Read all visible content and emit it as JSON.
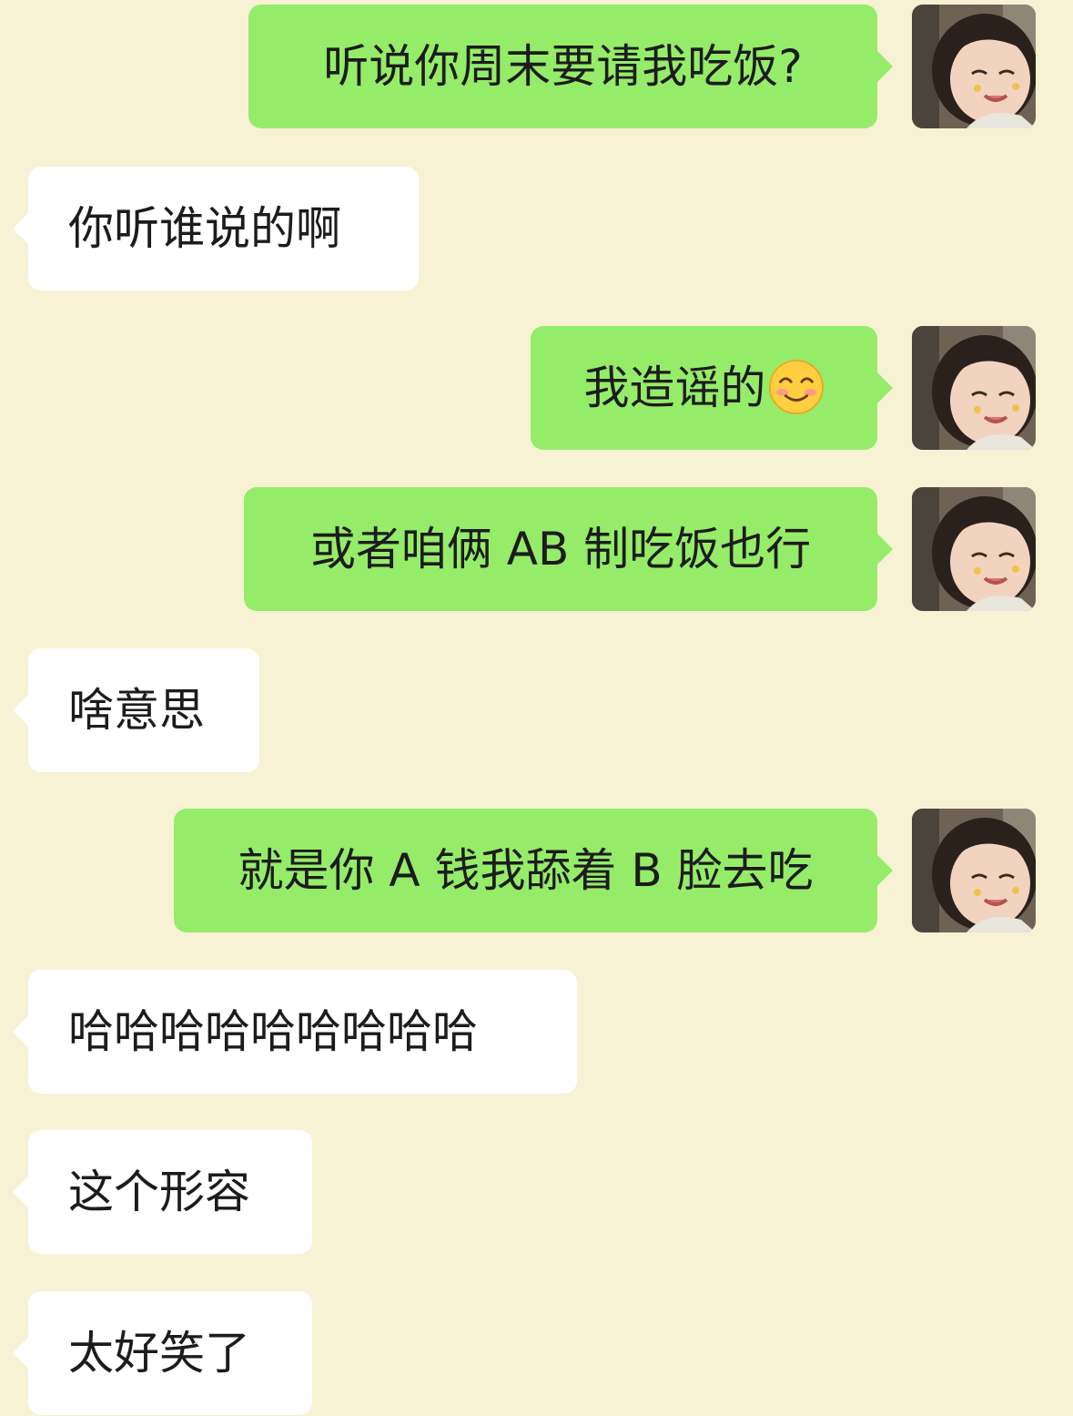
{
  "conversation": {
    "messages": [
      {
        "side": "out",
        "text": "听说你周末要请我吃饭?"
      },
      {
        "side": "in",
        "text": "你听谁说的啊"
      },
      {
        "side": "out",
        "text": "我造谣的",
        "emoji": "smiling-face-with-blush"
      },
      {
        "side": "out",
        "text": "或者咱俩 AB 制吃饭也行"
      },
      {
        "side": "in",
        "text": "啥意思"
      },
      {
        "side": "out",
        "text": "就是你 A 钱我舔着 B 脸去吃"
      },
      {
        "side": "in",
        "text": "哈哈哈哈哈哈哈哈哈"
      },
      {
        "side": "in",
        "text": "这个形容"
      },
      {
        "side": "in",
        "text": "太好笑了"
      }
    ]
  },
  "colors": {
    "background": "#f7f2d4",
    "outgoing_bubble": "#95ec69",
    "incoming_bubble": "#ffffff",
    "text": "#1c1c1c"
  },
  "icons": {
    "avatar": "user-photo-avatar",
    "emoji": "smiling-face-with-blush"
  }
}
